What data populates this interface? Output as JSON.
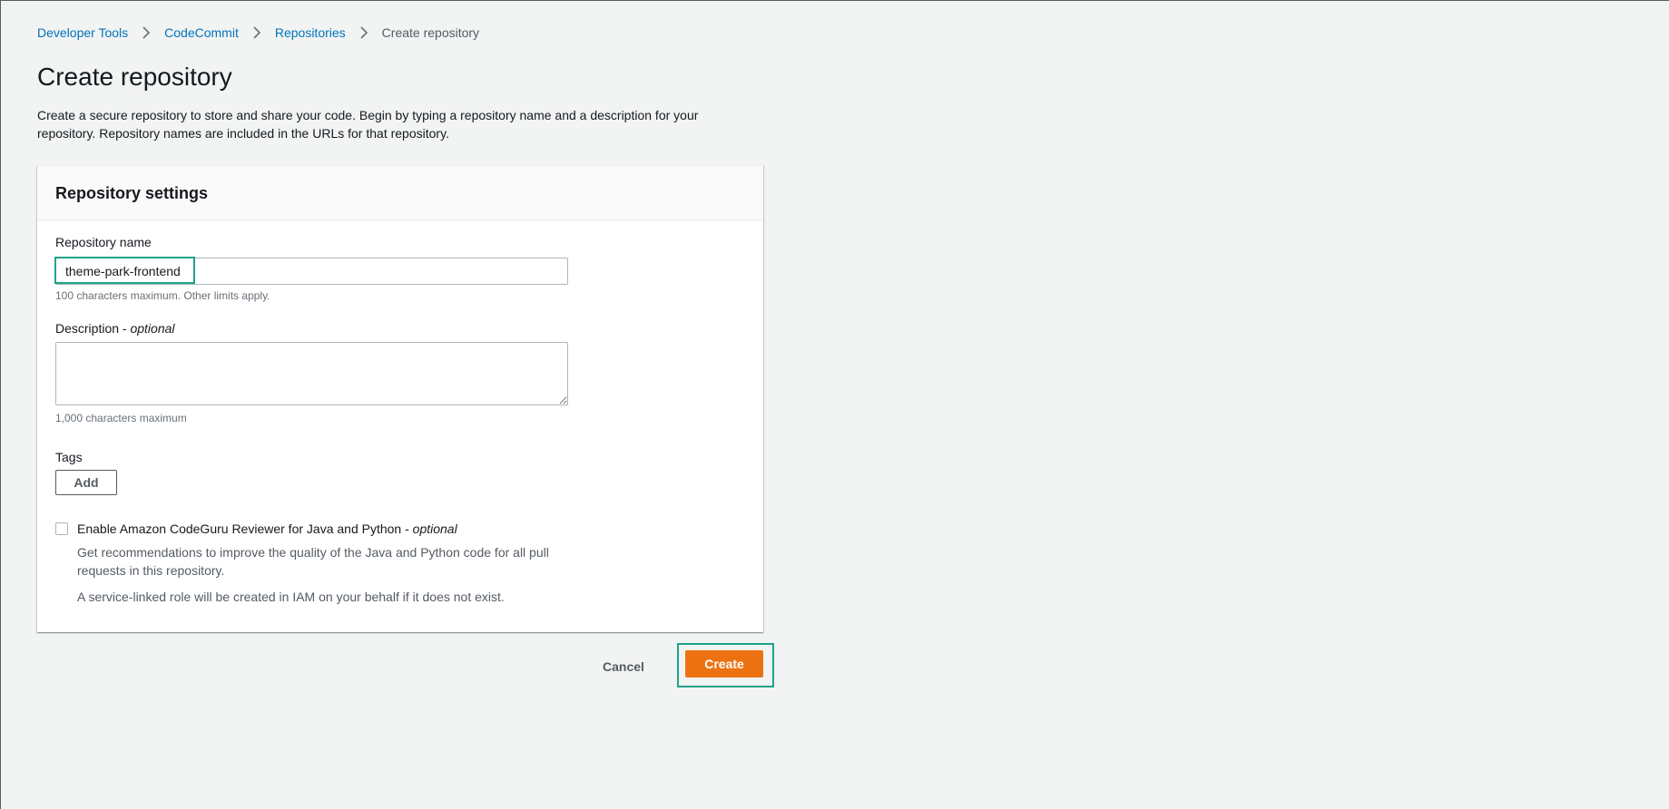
{
  "breadcrumb": {
    "items": [
      "Developer Tools",
      "CodeCommit",
      "Repositories"
    ],
    "current": "Create repository"
  },
  "header": {
    "title": "Create repository",
    "description": "Create a secure repository to store and share your code. Begin by typing a repository name and a description for your repository. Repository names are included in the URLs for that repository."
  },
  "settings": {
    "title": "Repository settings",
    "name_label": "Repository name",
    "name_value": "theme-park-frontend",
    "name_hint": "100 characters maximum. Other limits apply.",
    "description_label": "Description - ",
    "description_optional": "optional",
    "description_value": "",
    "description_hint": "1,000 characters maximum",
    "tags_label": "Tags",
    "add_label": "Add",
    "codeguru_label": "Enable Amazon CodeGuru Reviewer for Java and Python - ",
    "codeguru_optional": "optional",
    "codeguru_checked": false,
    "codeguru_desc1": "Get recommendations to improve the quality of the Java and Python code for all pull requests in this repository.",
    "codeguru_desc2": "A service-linked role will be created in IAM on your behalf if it does not exist."
  },
  "actions": {
    "cancel_label": "Cancel",
    "create_label": "Create"
  },
  "colors": {
    "link": "#0073bb",
    "primary_button": "#ec7211",
    "highlight": "#1fa38a",
    "background": "#f2f3f3"
  },
  "icons": {
    "breadcrumb_separator": "chevron-right-icon"
  }
}
